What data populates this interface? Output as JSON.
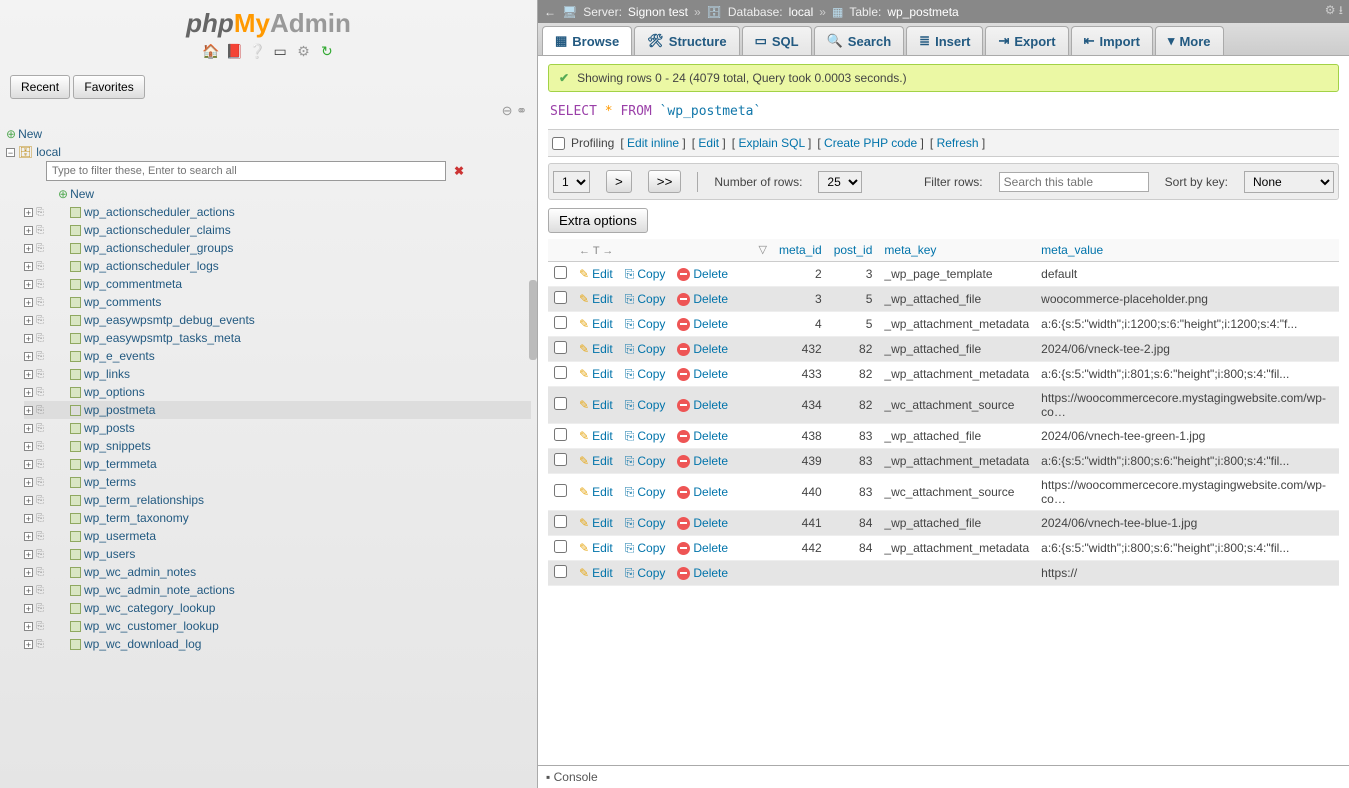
{
  "logo": {
    "p1": "php",
    "p2": "My",
    "p3": "Admin"
  },
  "recent_label": "Recent",
  "favorites_label": "Favorites",
  "tree": {
    "new_label": "New",
    "db_name": "local",
    "filter_placeholder": "Type to filter these, Enter to search all",
    "tables": [
      "wp_actionscheduler_actions",
      "wp_actionscheduler_claims",
      "wp_actionscheduler_groups",
      "wp_actionscheduler_logs",
      "wp_commentmeta",
      "wp_comments",
      "wp_easywpsmtp_debug_events",
      "wp_easywpsmtp_tasks_meta",
      "wp_e_events",
      "wp_links",
      "wp_options",
      "wp_postmeta",
      "wp_posts",
      "wp_snippets",
      "wp_termmeta",
      "wp_terms",
      "wp_term_relationships",
      "wp_term_taxonomy",
      "wp_usermeta",
      "wp_users",
      "wp_wc_admin_notes",
      "wp_wc_admin_note_actions",
      "wp_wc_category_lookup",
      "wp_wc_customer_lookup",
      "wp_wc_download_log"
    ],
    "selected_table": "wp_postmeta"
  },
  "breadcrumb": {
    "server_label": "Server:",
    "server_name": "Signon test",
    "db_label": "Database:",
    "db_name": "local",
    "table_label": "Table:",
    "table_name": "wp_postmeta"
  },
  "tabs": [
    {
      "label": "Browse",
      "ico": "▦"
    },
    {
      "label": "Structure",
      "ico": "🛠"
    },
    {
      "label": "SQL",
      "ico": "▭"
    },
    {
      "label": "Search",
      "ico": "🔍"
    },
    {
      "label": "Insert",
      "ico": "≣"
    },
    {
      "label": "Export",
      "ico": "⇥"
    },
    {
      "label": "Import",
      "ico": "⇤"
    },
    {
      "label": "More",
      "ico": "▾"
    }
  ],
  "active_tab": 0,
  "success_msg": "Showing rows 0 - 24 (4079 total, Query took 0.0003 seconds.)",
  "sql": {
    "select": "SELECT",
    "star": "*",
    "from": "FROM",
    "table": "`wp_postmeta`"
  },
  "row_actions": {
    "profiling": "Profiling",
    "edit_inline": "Edit inline",
    "edit": "Edit",
    "explain": "Explain SQL",
    "create_php": "Create PHP code",
    "refresh": "Refresh"
  },
  "pager": {
    "page": "1",
    "next": ">",
    "last": ">>",
    "rows_label": "Number of rows:",
    "rows": "25",
    "filter_label": "Filter rows:",
    "filter_ph": "Search this table",
    "sort_label": "Sort by key:",
    "sort_val": "None"
  },
  "extra_btn": "Extra options",
  "columns": [
    "meta_id",
    "post_id",
    "meta_key",
    "meta_value"
  ],
  "action_labels": {
    "edit": "Edit",
    "copy": "Copy",
    "delete": "Delete"
  },
  "rows": [
    {
      "meta_id": "2",
      "post_id": "3",
      "meta_key": "_wp_page_template",
      "meta_value": "default"
    },
    {
      "meta_id": "3",
      "post_id": "5",
      "meta_key": "_wp_attached_file",
      "meta_value": "woocommerce-placeholder.png"
    },
    {
      "meta_id": "4",
      "post_id": "5",
      "meta_key": "_wp_attachment_metadata",
      "meta_value": "a:6:{s:5:\"width\";i:1200;s:6:\"height\";i:1200;s:4:\"f..."
    },
    {
      "meta_id": "432",
      "post_id": "82",
      "meta_key": "_wp_attached_file",
      "meta_value": "2024/06/vneck-tee-2.jpg"
    },
    {
      "meta_id": "433",
      "post_id": "82",
      "meta_key": "_wp_attachment_metadata",
      "meta_value": "a:6:{s:5:\"width\";i:801;s:6:\"height\";i:800;s:4:\"fil..."
    },
    {
      "meta_id": "434",
      "post_id": "82",
      "meta_key": "_wc_attachment_source",
      "meta_value": "https://woocommercecore.mystagingwebsite.com/wp-co…"
    },
    {
      "meta_id": "438",
      "post_id": "83",
      "meta_key": "_wp_attached_file",
      "meta_value": "2024/06/vnech-tee-green-1.jpg"
    },
    {
      "meta_id": "439",
      "post_id": "83",
      "meta_key": "_wp_attachment_metadata",
      "meta_value": "a:6:{s:5:\"width\";i:800;s:6:\"height\";i:800;s:4:\"fil..."
    },
    {
      "meta_id": "440",
      "post_id": "83",
      "meta_key": "_wc_attachment_source",
      "meta_value": "https://woocommercecore.mystagingwebsite.com/wp-co…"
    },
    {
      "meta_id": "441",
      "post_id": "84",
      "meta_key": "_wp_attached_file",
      "meta_value": "2024/06/vnech-tee-blue-1.jpg"
    },
    {
      "meta_id": "442",
      "post_id": "84",
      "meta_key": "_wp_attachment_metadata",
      "meta_value": "a:6:{s:5:\"width\";i:800;s:6:\"height\";i:800;s:4:\"fil..."
    },
    {
      "meta_id": "",
      "post_id": "",
      "meta_key": "",
      "meta_value": "https://"
    }
  ],
  "console_label": "Console"
}
